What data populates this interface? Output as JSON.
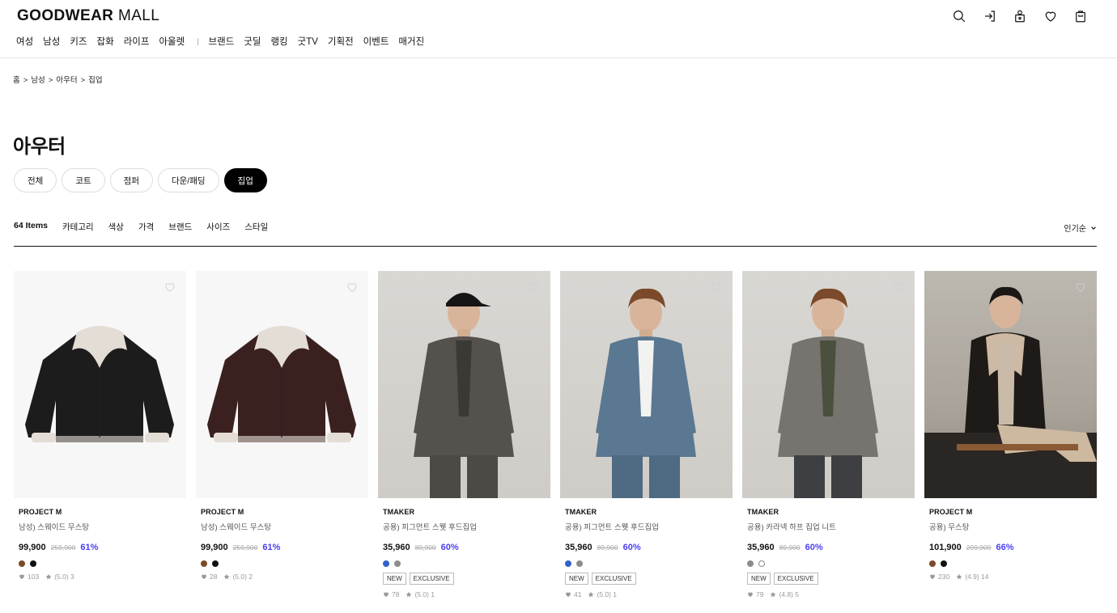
{
  "header": {
    "logo_bold": "GOODWEAR",
    "logo_light": "MALL",
    "icons": [
      "search-icon",
      "login-icon",
      "mypage-icon",
      "wishlist-icon",
      "cart-icon"
    ]
  },
  "gnb": {
    "primary": [
      "여성",
      "남성",
      "키즈",
      "잡화",
      "라이프",
      "아울렛"
    ],
    "separator": "|",
    "secondary": [
      "브랜드",
      "굿딜",
      "랭킹",
      "굿TV",
      "기획전",
      "이벤트",
      "매거진"
    ]
  },
  "breadcrumb": [
    "홈",
    "남성",
    "아우터",
    "집업"
  ],
  "breadcrumb_sep": ">",
  "page_title": "아우터",
  "chips": [
    {
      "label": "전체",
      "active": false
    },
    {
      "label": "코트",
      "active": false
    },
    {
      "label": "점퍼",
      "active": false
    },
    {
      "label": "다운/패딩",
      "active": false
    },
    {
      "label": "집업",
      "active": true
    }
  ],
  "filterbar": {
    "count": "64 Items",
    "filters": [
      "카테고리",
      "색상",
      "가격",
      "브랜드",
      "사이즈",
      "스타일"
    ],
    "sort": "인기순"
  },
  "colors": {
    "discount": "#4b3ff0",
    "brown": "#7a4a2a",
    "black": "#111111",
    "blue": "#2f63c8",
    "gray": "#8c8c8c"
  },
  "products": [
    {
      "brand": "PROJECT M",
      "name": "남성) 스웨이드 무스탕",
      "price": "99,900",
      "original": "259,900",
      "discount": "61%",
      "swatches": [
        "#7a4a2a",
        "#111111"
      ],
      "badges": [],
      "likes": "103",
      "rating": "(5.0) 3",
      "image": "black-shearling-jacket"
    },
    {
      "brand": "PROJECT M",
      "name": "남성) 스웨이드 무스탕",
      "price": "99,900",
      "original": "259,900",
      "discount": "61%",
      "swatches": [
        "#7a4a2a",
        "#111111"
      ],
      "badges": [],
      "likes": "28",
      "rating": "(5.0) 2",
      "image": "brown-shearling-jacket"
    },
    {
      "brand": "TMAKER",
      "name": "공용) 피그먼트 스웻 후드집업",
      "price": "35,960",
      "original": "89,900",
      "discount": "60%",
      "swatches": [
        "#2f63c8",
        "#8c8c8c"
      ],
      "badges": [
        "NEW",
        "EXCLUSIVE"
      ],
      "likes": "78",
      "rating": "(5.0) 1",
      "image": "model-gray-hoodie"
    },
    {
      "brand": "TMAKER",
      "name": "공용) 피그먼트 스웻 후드집업",
      "price": "35,960",
      "original": "89,900",
      "discount": "60%",
      "swatches": [
        "#2f63c8",
        "#8c8c8c"
      ],
      "badges": [
        "NEW",
        "EXCLUSIVE"
      ],
      "likes": "41",
      "rating": "(5.0) 1",
      "image": "model-blue-hoodie"
    },
    {
      "brand": "TMAKER",
      "name": "공용) 카라넥 하프 집업 니트",
      "price": "35,960",
      "original": "89,900",
      "discount": "60%",
      "swatches": [
        "#8c8c8c",
        "outline"
      ],
      "badges": [
        "NEW",
        "EXCLUSIVE"
      ],
      "likes": "79",
      "rating": "(4.8) 5",
      "image": "model-gray-knit"
    },
    {
      "brand": "PROJECT M",
      "name": "공용) 무스탕",
      "price": "101,900",
      "original": "299,900",
      "discount": "66%",
      "swatches": [
        "#7a4a2a",
        "#111111"
      ],
      "badges": [],
      "likes": "230",
      "rating": "(4.9) 14",
      "image": "model-shearling-seated"
    }
  ]
}
